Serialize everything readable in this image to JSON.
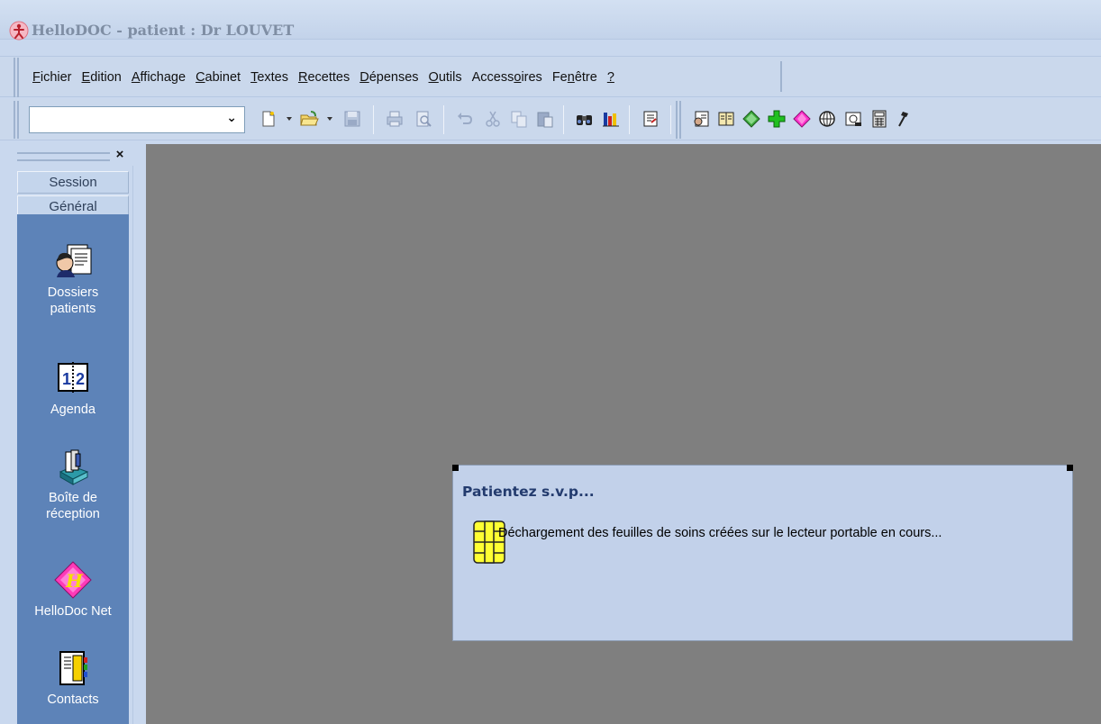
{
  "window": {
    "title": "HelloDOC - patient : Dr LOUVET"
  },
  "menu": {
    "items": [
      {
        "pre": "",
        "key": "F",
        "post": "ichier"
      },
      {
        "pre": "",
        "key": "E",
        "post": "dition"
      },
      {
        "pre": "",
        "key": "A",
        "post": "ffichage"
      },
      {
        "pre": "",
        "key": "C",
        "post": "abinet"
      },
      {
        "pre": "",
        "key": "T",
        "post": "extes"
      },
      {
        "pre": "",
        "key": "R",
        "post": "ecettes"
      },
      {
        "pre": "",
        "key": "D",
        "post": "épenses"
      },
      {
        "pre": "",
        "key": "O",
        "post": "utils"
      },
      {
        "pre": "Access",
        "key": "o",
        "post": "ires"
      },
      {
        "pre": "Fe",
        "key": "n",
        "post": "être"
      },
      {
        "pre": "",
        "key": "?",
        "post": ""
      }
    ]
  },
  "toolbar": {
    "combo_value": "",
    "icons": [
      "new-document-icon",
      "open-folder-icon",
      "save-icon",
      "print-icon",
      "print-preview-icon",
      "undo-icon",
      "cut-icon",
      "copy-icon",
      "paste-icon",
      "find-icon",
      "chart-icon",
      "report-icon",
      "patient-record-icon",
      "book-icon",
      "green-diamond-icon",
      "green-cross-icon",
      "pink-diamond-icon",
      "globe-icon",
      "scanner-icon",
      "calculator-icon",
      "hammer-icon"
    ]
  },
  "sidebar": {
    "close_label": "×",
    "tabs": [
      "Session",
      "Général"
    ],
    "items": [
      {
        "label_1": "Dossiers",
        "label_2": "patients",
        "icon": "patient-file-icon"
      },
      {
        "label_1": "Agenda",
        "label_2": "",
        "icon": "agenda-icon"
      },
      {
        "label_1": "Boîte de",
        "label_2": "réception",
        "icon": "inbox-icon"
      },
      {
        "label_1": "HelloDoc Net",
        "label_2": "",
        "icon": "hellodoc-net-icon"
      },
      {
        "label_1": "Contacts",
        "label_2": "",
        "icon": "contacts-icon"
      }
    ]
  },
  "dialog": {
    "title": "Patientez s.v.p...",
    "message": "Déchargement des feuilles de soins créées sur le lecteur portable en cours..."
  }
}
